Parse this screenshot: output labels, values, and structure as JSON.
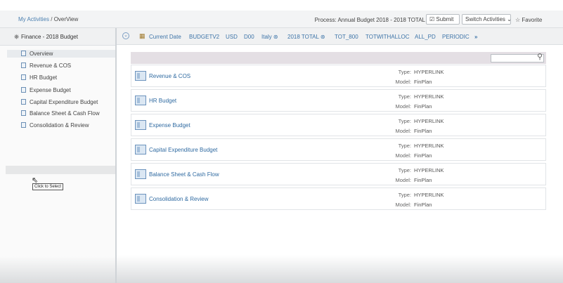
{
  "breadcrumb": {
    "root": "My Activities",
    "separator": " / ",
    "current": "OverView"
  },
  "process_label": "Process:  Annual Budget 2018 - 2018 TOTAL",
  "buttons": {
    "submit": "Submit",
    "switch": "Switch Activities",
    "favorite": "Favorite"
  },
  "sidebar": {
    "model": "Finance - 2018 Budget",
    "items": [
      {
        "label": "Overview"
      },
      {
        "label": "Revenue & COS"
      },
      {
        "label": "HR Budget"
      },
      {
        "label": "Expense Budget"
      },
      {
        "label": "Capital Expenditure Budget"
      },
      {
        "label": "Balance Sheet & Cash Flow"
      },
      {
        "label": "Consolidation & Review"
      }
    ],
    "tooltip": "Click to Select"
  },
  "context": {
    "current_date": "Current Date",
    "items": [
      "BUDGETV2",
      "USD",
      "D00",
      "Italy",
      "2018 TOTAL",
      "TOT_800",
      "TOTWITHALLOC",
      "ALL_PD",
      "PERIODIC"
    ],
    "more": "»"
  },
  "search": {
    "placeholder": ""
  },
  "labels": {
    "type": "Type:",
    "model": "Model:"
  },
  "cards": [
    {
      "title": "Revenue & COS",
      "type": "HYPERLINK",
      "model": "FinPlan"
    },
    {
      "title": "HR Budget",
      "type": "HYPERLINK",
      "model": "FinPlan"
    },
    {
      "title": "Expense Budget",
      "type": "HYPERLINK",
      "model": "FinPlan"
    },
    {
      "title": "Capital Expenditure Budget",
      "type": "HYPERLINK",
      "model": "FinPlan"
    },
    {
      "title": "Balance Sheet & Cash Flow",
      "type": "HYPERLINK",
      "model": "FinPlan"
    },
    {
      "title": "Consolidation & Review",
      "type": "HYPERLINK",
      "model": "FinPlan"
    }
  ],
  "colors": {
    "link": "#2f6aa1",
    "accent": "#4a7fb0"
  }
}
